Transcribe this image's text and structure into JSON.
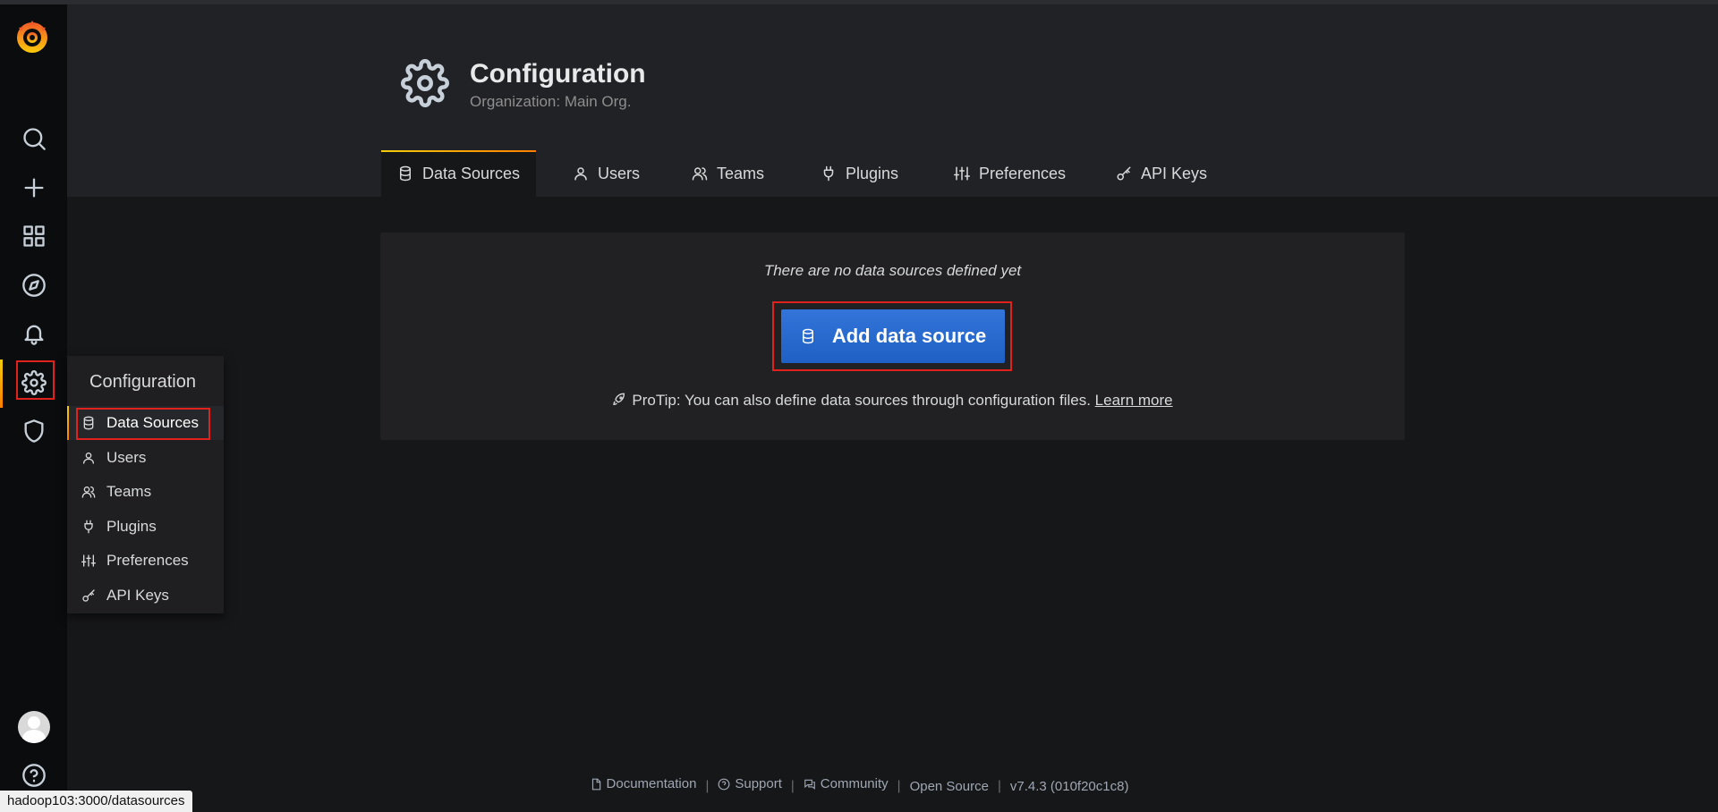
{
  "sidebar": {
    "logo": "grafana-logo",
    "items": [
      {
        "name": "search",
        "icon": "search-icon"
      },
      {
        "name": "create",
        "icon": "plus-icon"
      },
      {
        "name": "dashboards",
        "icon": "apps-icon"
      },
      {
        "name": "explore",
        "icon": "compass-icon"
      },
      {
        "name": "alerting",
        "icon": "bell-icon"
      },
      {
        "name": "configuration",
        "icon": "gear-icon",
        "active": true
      },
      {
        "name": "server-admin",
        "icon": "shield-icon"
      }
    ],
    "avatar": "user-avatar",
    "help_icon": "question-circle-icon"
  },
  "flyout": {
    "title": "Configuration",
    "items": [
      {
        "label": "Data Sources",
        "icon": "database-icon",
        "active": true
      },
      {
        "label": "Users",
        "icon": "user-icon"
      },
      {
        "label": "Teams",
        "icon": "users-icon"
      },
      {
        "label": "Plugins",
        "icon": "plug-icon"
      },
      {
        "label": "Preferences",
        "icon": "sliders-icon"
      },
      {
        "label": "API Keys",
        "icon": "key-icon"
      }
    ]
  },
  "header": {
    "title": "Configuration",
    "subtitle": "Organization: Main Org.",
    "icon": "gear-icon"
  },
  "tabs": [
    {
      "label": "Data Sources",
      "icon": "database-icon",
      "active": true
    },
    {
      "label": "Users",
      "icon": "user-icon"
    },
    {
      "label": "Teams",
      "icon": "users-icon"
    },
    {
      "label": "Plugins",
      "icon": "plug-icon"
    },
    {
      "label": "Preferences",
      "icon": "sliders-icon"
    },
    {
      "label": "API Keys",
      "icon": "key-icon"
    }
  ],
  "empty_state": {
    "message": "There are no data sources defined yet",
    "button_label": "Add data source",
    "protip_text": "ProTip: You can also define data sources through configuration files.",
    "learn_more": "Learn more"
  },
  "footer": {
    "documentation": "Documentation",
    "support": "Support",
    "community": "Community",
    "open_source": "Open Source",
    "version": "v7.4.3 (010f20c1c8)",
    "separator": "|"
  },
  "statusbar": {
    "url": "hadoop103:3000/datasources"
  },
  "colors": {
    "accent_orange": "#ff7f00",
    "primary_blue": "#1f60c4",
    "highlight_red": "#e0211c",
    "background": "#161719"
  }
}
